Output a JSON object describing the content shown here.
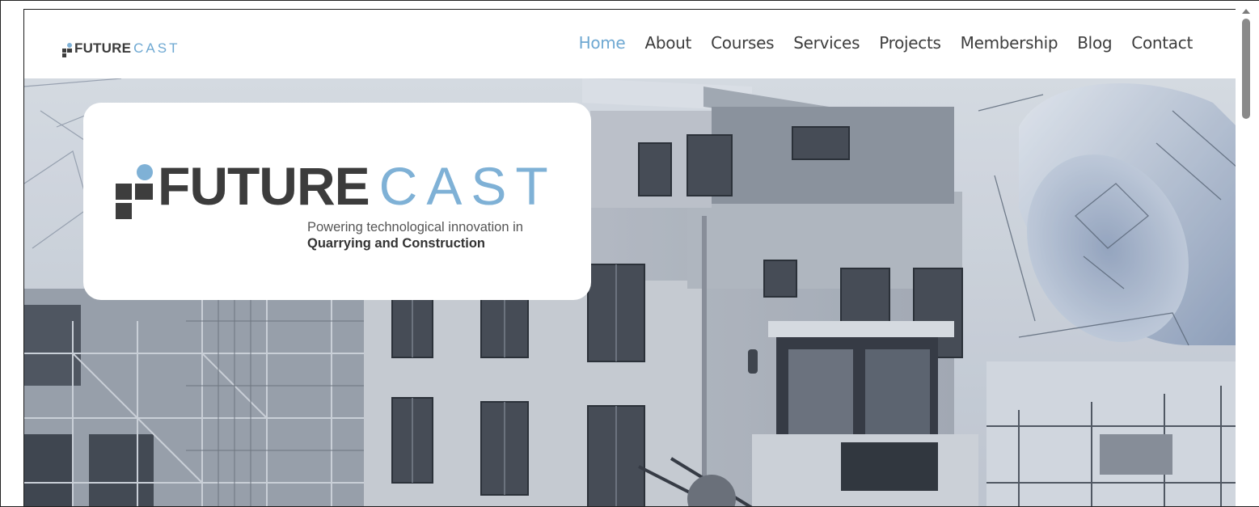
{
  "brand": {
    "name_bold": "FUTURE",
    "name_light": "CAST"
  },
  "nav": {
    "items": [
      {
        "label": "Home",
        "active": true
      },
      {
        "label": "About",
        "active": false
      },
      {
        "label": "Courses",
        "active": false
      },
      {
        "label": "Services",
        "active": false
      },
      {
        "label": "Projects",
        "active": false
      },
      {
        "label": "Membership",
        "active": false
      },
      {
        "label": "Blog",
        "active": false
      },
      {
        "label": "Contact",
        "active": false
      }
    ]
  },
  "hero": {
    "logo_bold": "FUTURE",
    "logo_light": "CAST",
    "tagline_line1": "Powering technological innovation in",
    "tagline_line2": "Quarrying and Construction"
  },
  "colors": {
    "accent": "#6ea8d2",
    "text_dark": "#3d3d3d",
    "hero_tint": "#c7ccd4"
  }
}
